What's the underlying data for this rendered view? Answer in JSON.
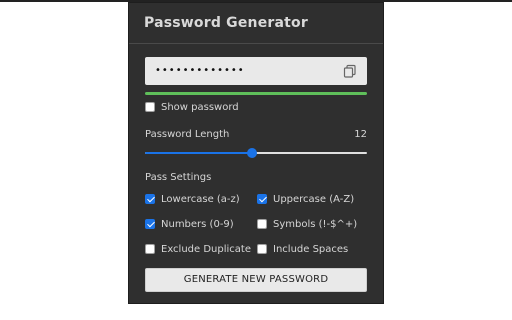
{
  "app": {
    "title": "Password Generator"
  },
  "password": {
    "masked_value": "•••••••••••••",
    "strength_fraction": 1.0,
    "strength_color": "#5fbf5a",
    "copy_icon": "copy-icon"
  },
  "show_password": {
    "label": "Show password",
    "checked": false
  },
  "length": {
    "label": "Password Length",
    "value": "12",
    "slider_fraction": 0.48
  },
  "settings": {
    "label": "Pass Settings",
    "options": [
      {
        "label": "Lowercase (a-z)",
        "checked": true
      },
      {
        "label": "Uppercase (A-Z)",
        "checked": true
      },
      {
        "label": "Numbers (0-9)",
        "checked": true
      },
      {
        "label": "Symbols (!-$^+)",
        "checked": false
      },
      {
        "label": "Exclude Duplicate",
        "checked": false
      },
      {
        "label": "Include Spaces",
        "checked": false
      }
    ]
  },
  "actions": {
    "generate_label": "GENERATE NEW PASSWORD"
  },
  "colors": {
    "panel_bg": "#2f2f2f",
    "accent": "#1a73e8",
    "strength_good": "#5fbf5a"
  }
}
